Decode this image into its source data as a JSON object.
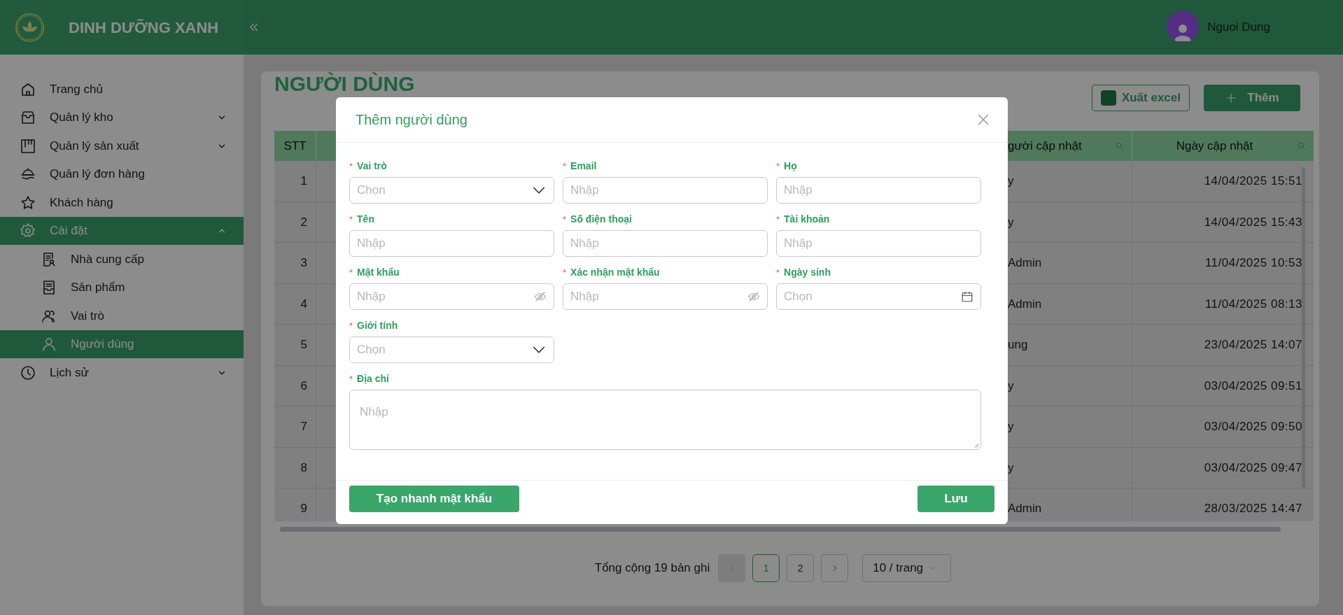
{
  "header": {
    "brand": "DINH DƯỠNG XANH",
    "user_name": "Nguoi Dung"
  },
  "sidebar": {
    "items": [
      {
        "label": "Trang chủ",
        "selected": false
      },
      {
        "label": "Quản lý kho",
        "selected": false,
        "expanded": false
      },
      {
        "label": "Quản lý sản xuất",
        "selected": false,
        "expanded": false
      },
      {
        "label": "Quản lý đơn hàng",
        "selected": false
      },
      {
        "label": "Khách hàng",
        "selected": false
      },
      {
        "label": "Cài đặt",
        "selected": true,
        "expanded": true,
        "children": [
          {
            "label": "Nhà cung cấp",
            "selected": false
          },
          {
            "label": "Sản phẩm",
            "selected": false
          },
          {
            "label": "Vai trò",
            "selected": false
          },
          {
            "label": "Người dùng",
            "selected": true
          }
        ]
      },
      {
        "label": "Lịch sử",
        "selected": false,
        "expanded": false
      }
    ]
  },
  "page": {
    "title": "NGƯỜI DÙNG",
    "buttons": [
      {
        "label": "Xuất excel",
        "kind": "export"
      },
      {
        "label": "Thêm",
        "kind": "add"
      }
    ]
  },
  "table": {
    "columns": [
      "STT",
      "gười cập nhật",
      "Ngày cập nhật"
    ],
    "rows": [
      {
        "stt": "1",
        "updated_by": "y",
        "updated_at": "14/04/2025 15:51"
      },
      {
        "stt": "2",
        "updated_by": "y",
        "updated_at": "14/04/2025 15:43"
      },
      {
        "stt": "3",
        "updated_by": "Admin",
        "updated_at": "11/04/2025 10:53"
      },
      {
        "stt": "4",
        "updated_by": "Admin",
        "updated_at": "11/04/2025 08:13"
      },
      {
        "stt": "5",
        "updated_by": "ung",
        "updated_at": "23/04/2025 14:07"
      },
      {
        "stt": "6",
        "updated_by": "y",
        "updated_at": "03/04/2025 09:51"
      },
      {
        "stt": "7",
        "updated_by": "y",
        "updated_at": "03/04/2025 09:50"
      },
      {
        "stt": "8",
        "updated_by": "y",
        "updated_at": "03/04/2025 09:47"
      },
      {
        "stt": "9",
        "updated_by": "Admin",
        "updated_at": "28/03/2025 14:47"
      }
    ]
  },
  "pagination": {
    "total": "Tổng cộng 19 bản ghi",
    "prev_disabled": true,
    "pages": [
      {
        "label": "1",
        "selected": true
      },
      {
        "label": "2",
        "selected": false
      }
    ],
    "page_size": "10 / trang"
  },
  "modal": {
    "title": "Thêm người dùng",
    "fields": [
      {
        "label": "Vai trò",
        "required_mark": "*",
        "kind": "select",
        "placeholder": "Chọn"
      },
      {
        "label": "Email",
        "required_mark": "*",
        "kind": "text",
        "placeholder": "Nhập"
      },
      {
        "label": "Họ",
        "required_mark": "*",
        "kind": "text",
        "placeholder": "Nhập"
      },
      {
        "label": "Tên",
        "required_mark": "*",
        "kind": "text",
        "placeholder": "Nhập"
      },
      {
        "label": "Số điện thoại",
        "required_mark": "*",
        "kind": "text",
        "placeholder": "Nhập"
      },
      {
        "label": "Tài khoản",
        "required_mark": "*",
        "kind": "text",
        "placeholder": "Nhập"
      },
      {
        "label": "Mật khẩu",
        "required_mark": "*",
        "kind": "password",
        "placeholder": "Nhập"
      },
      {
        "label": "Xác nhận mật khẩu",
        "required_mark": "*",
        "kind": "password",
        "placeholder": "Nhập"
      },
      {
        "label": "Ngày sinh",
        "required_mark": "*",
        "kind": "date",
        "placeholder": "Chọn"
      },
      {
        "label": "Giới tính",
        "required_mark": "*",
        "kind": "select",
        "placeholder": "Chọn"
      },
      {
        "label": "Địa chỉ",
        "required_mark": "*",
        "kind": "textarea",
        "placeholder": "Nhập"
      }
    ],
    "buttons": [
      {
        "label": "Tạo nhanh mật khẩu",
        "kind": "generate"
      },
      {
        "label": "Lưu",
        "kind": "save"
      }
    ]
  }
}
